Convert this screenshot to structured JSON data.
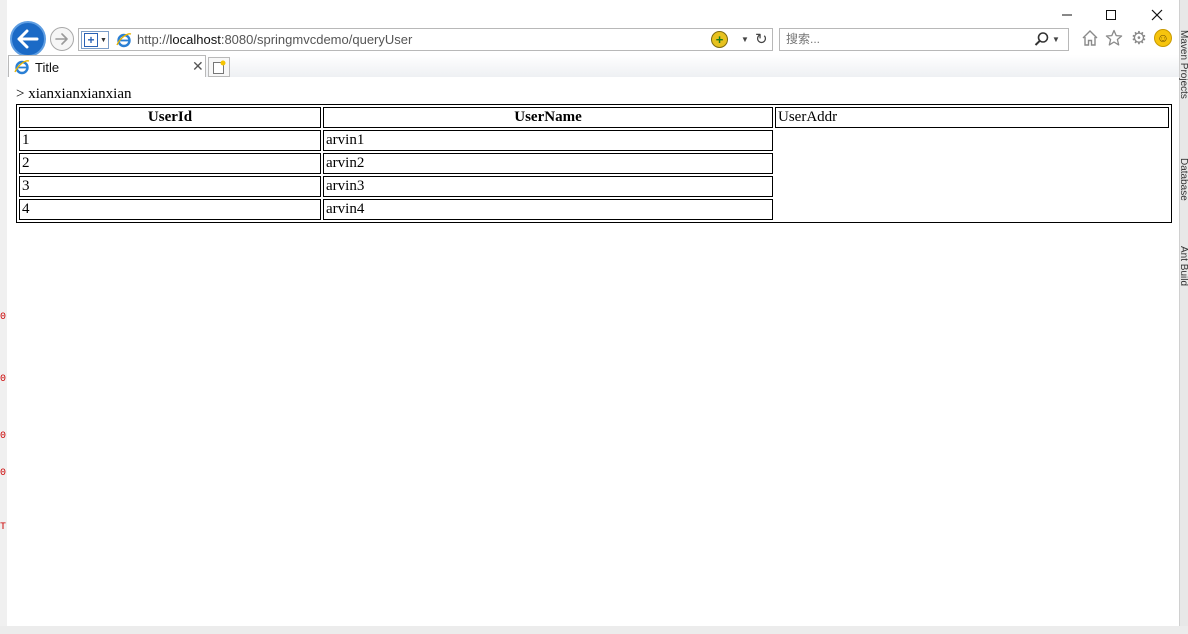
{
  "window": {
    "minimize_label": "—",
    "maximize_label": "☐",
    "close_label": "✕"
  },
  "browser": {
    "url_prefix": "http://",
    "url_host": "localhost",
    "url_rest": ":8080/springmvcdemo/queryUser",
    "search_placeholder": "搜索...",
    "tab_title": "Title"
  },
  "page": {
    "heading": "> xianxianxianxian",
    "table": {
      "columns": [
        "UserId",
        "UserName",
        "UserAddr"
      ],
      "rows": [
        {
          "id": "1",
          "name": "arvin1",
          "addr": ""
        },
        {
          "id": "2",
          "name": "arvin2",
          "addr": ""
        },
        {
          "id": "3",
          "name": "arvin3",
          "addr": ""
        },
        {
          "id": "4",
          "name": "arvin4",
          "addr": ""
        }
      ]
    }
  },
  "background_ide": {
    "right_tabs": [
      "Maven Projects",
      "Database",
      "Ant Build"
    ]
  },
  "colors": {
    "back_button": "#1b6ac6",
    "ie_icon": "#2a7fd4"
  }
}
